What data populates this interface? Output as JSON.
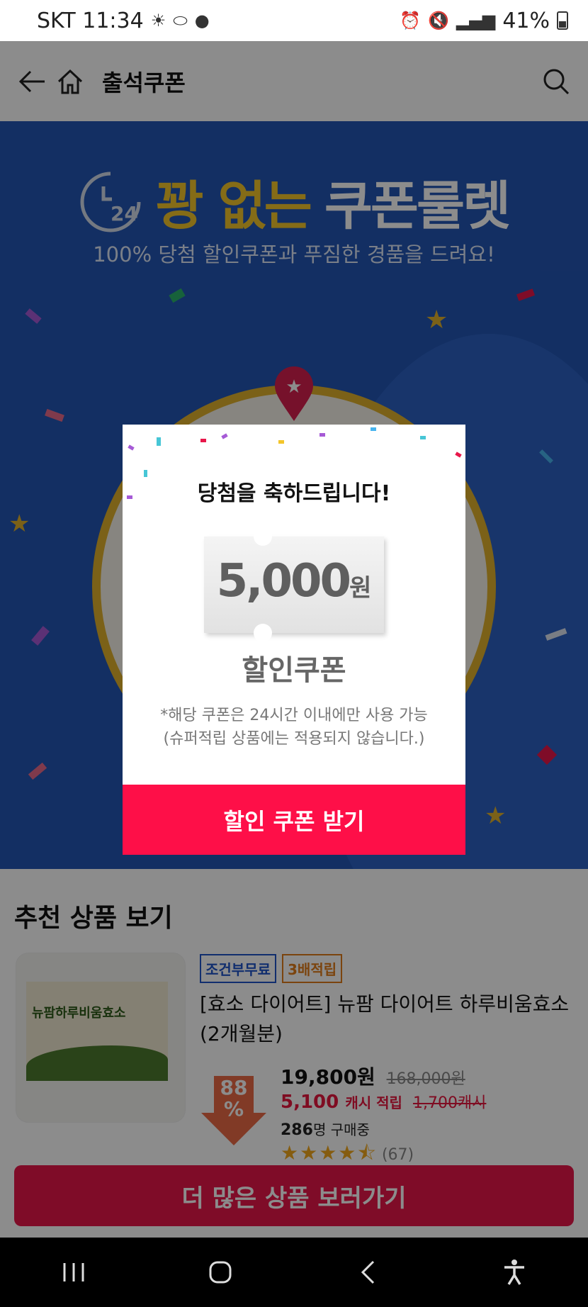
{
  "status_bar": {
    "carrier_time": "SKT 11:34",
    "battery": "41%"
  },
  "header": {
    "title": "출석쿠폰"
  },
  "banner": {
    "clock_label": "24",
    "title_yellow": "꽝 없는",
    "title_white": "쿠폰룰렛",
    "subtitle": "100% 당첨 할인쿠폰과 푸짐한 경품을 드려요!"
  },
  "modal": {
    "title": "당첨을 축하드립니다!",
    "coupon_amount": "5,000",
    "coupon_unit": "원",
    "coupon_type": "할인쿠폰",
    "note_line1": "*해당 쿠폰은 24시간 이내에만 사용 가능",
    "note_line2": "(슈퍼적립 상품에는 적용되지 않습니다.)",
    "button": "할인 쿠폰 받기"
  },
  "recommend": {
    "heading": "추천 상품 보기",
    "product": {
      "tag1": "조건부무료",
      "tag2": "3배적립",
      "name": "[효소 다이어트] 뉴팜 다이어트 하루비움효소(2개월분)",
      "thumb_text": "뉴팜하루비움효소",
      "discount": "88",
      "discount_unit": "%",
      "price": "19,800원",
      "orig_price": "168,000원",
      "cash": "5,100",
      "cash_label": "캐시 적립",
      "orig_cash": "1,700캐시",
      "buyers_count": "286",
      "buyers_label": "명 구매중",
      "rating_stars": "★★★★⯪",
      "review_count": "(67)"
    },
    "more_button": "더 많은 상품 보러가기"
  },
  "colors": {
    "banner_blue": "#2456b4",
    "accent_red": "#fe0f48",
    "gold": "#f3c52a"
  }
}
